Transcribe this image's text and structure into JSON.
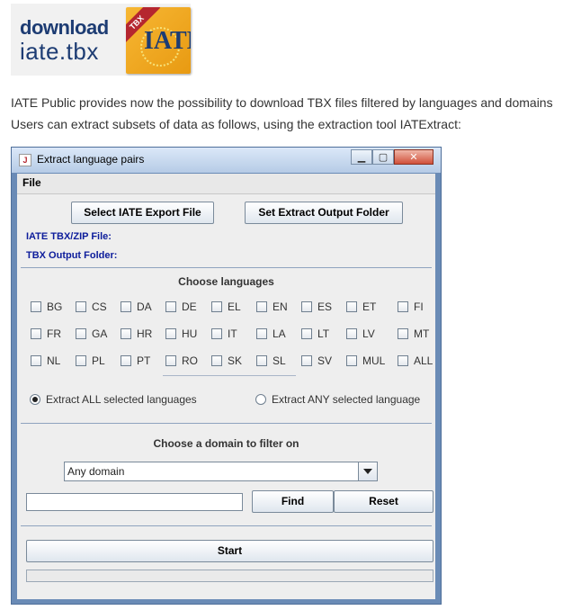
{
  "logo": {
    "line1": "download",
    "line2": "iate.tbx",
    "ribbon": "TBX",
    "badge": "IATE"
  },
  "intro": {
    "line1": "IATE Public provides now the possibility to download TBX files filtered by languages and domains",
    "line2": "Users can extract subsets of data as follows, using the extraction tool IATExtract:"
  },
  "window": {
    "title": "Extract language pairs",
    "menu": {
      "file": "File"
    },
    "buttons": {
      "select_export": "Select IATE Export File",
      "set_output": "Set Extract Output Folder",
      "find": "Find",
      "reset": "Reset",
      "start": "Start"
    },
    "labels": {
      "tbx_zip": "IATE TBX/ZIP File:",
      "tbx_output": "TBX Output Folder:",
      "choose_languages": "Choose languages",
      "choose_domain": "Choose a domain to filter on"
    },
    "languages": [
      [
        "BG",
        "CS",
        "DA",
        "DE",
        "EL",
        "EN",
        "ES",
        "ET",
        "FI"
      ],
      [
        "FR",
        "GA",
        "HR",
        "HU",
        "IT",
        "LA",
        "LT",
        "LV",
        "MT"
      ],
      [
        "NL",
        "PL",
        "PT",
        "RO",
        "SK",
        "SL",
        "SV",
        "MUL",
        "ALL"
      ]
    ],
    "radios": {
      "all": "Extract ALL selected languages",
      "any": "Extract ANY selected language",
      "selected": "all"
    },
    "domain": {
      "value": "Any domain"
    },
    "search": {
      "value": ""
    },
    "progress": 0
  }
}
